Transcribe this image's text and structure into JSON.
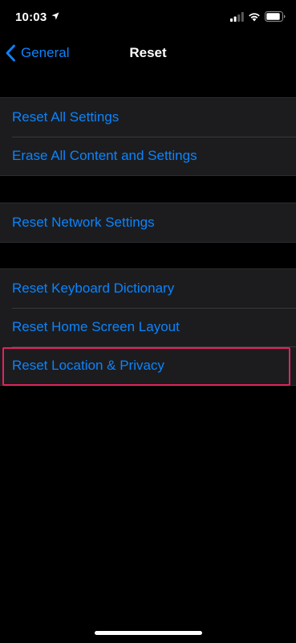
{
  "status_bar": {
    "time": "10:03",
    "icons": [
      "location-arrow-icon",
      "signal-icon",
      "wifi-icon",
      "battery-icon"
    ]
  },
  "nav": {
    "back_label": "General",
    "title": "Reset"
  },
  "groups": [
    {
      "items": [
        {
          "label": "Reset All Settings"
        },
        {
          "label": "Erase All Content and Settings"
        }
      ]
    },
    {
      "items": [
        {
          "label": "Reset Network Settings"
        }
      ]
    },
    {
      "items": [
        {
          "label": "Reset Keyboard Dictionary"
        },
        {
          "label": "Reset Home Screen Layout"
        },
        {
          "label": "Reset Location & Privacy"
        }
      ]
    }
  ],
  "colors": {
    "background": "#000000",
    "cell_background": "#1c1c1e",
    "accent": "#0a84ff",
    "highlight": "#e0245e",
    "text": "#ffffff"
  }
}
